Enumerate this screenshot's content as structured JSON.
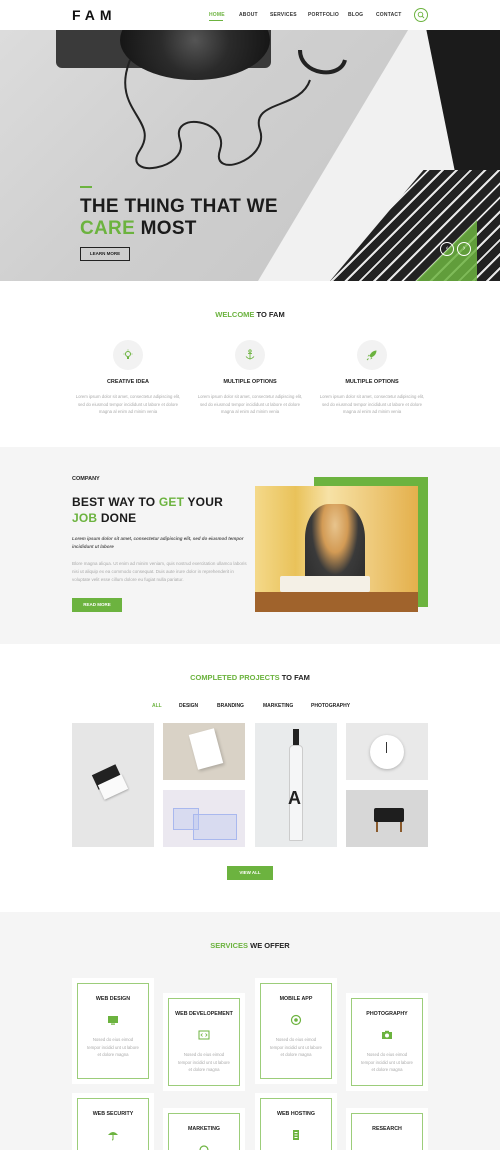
{
  "header": {
    "logo": "FAM",
    "nav": [
      "HOME",
      "ABOUT",
      "SERVICES",
      "PORTFOLIO",
      "BLOG",
      "CONTACT"
    ]
  },
  "hero": {
    "line1": "THE THING THAT WE",
    "line2_accent": "CARE",
    "line2_rest": " MOST",
    "button": "LEARN MORE"
  },
  "welcome": {
    "title_accent": "WELCOME",
    "title_rest": " TO FAM",
    "features": [
      {
        "title": "CREATIVE IDEA",
        "icon": "lightbulb-icon",
        "text": "Lorem ipsum dolor sit amet, consectetur adipiscing elit, sed do eiusmod tempor incididunt ut labore et dolore magna al enim ad minim venia"
      },
      {
        "title": "MULTIPLE OPTIONS",
        "icon": "anchor-icon",
        "text": "Lorem ipsum dolor sit amet, consectetur adipiscing elit, sed do eiusmod tempor incididunt ut labore et dolore magna al enim ad minim venia"
      },
      {
        "title": "MULTIPLE OPTIONS",
        "icon": "rocket-icon",
        "text": "Lorem ipsum dolor sit amet, consectetur adipiscing elit, sed do eiusmod tempor incididunt ut labore et dolore magna al enim ad minim venia"
      }
    ]
  },
  "company": {
    "label": "COMPANY",
    "h1_a": "BEST WAY TO ",
    "h1_accent": "GET",
    "h1_b": " YOUR",
    "h2_accent": "JOB",
    "h2_b": " DONE",
    "italic": "Lorem ipsum dolor sit amet, consectetur adipiscing elit, sed do eiusmod tempor incididunt ut labore",
    "text": "Blore magna aliqua. Ut enim ad minim veniam, quis nostrud exercitation ullamco laboris nisi ut aliquip ex ea commodo consequat. Duis aute irure dolor in reprehenderit in voluptate velit esse cillum dolore eu fugiat nulla pariatur.",
    "button": "READ MORE"
  },
  "projects": {
    "title_accent": "COMPLETED PROJECTS",
    "title_rest": " TO FAM",
    "filters": [
      "ALL",
      "DESIGN",
      "BRANDING",
      "MARKETING",
      "PHOTOGRAPHY"
    ],
    "button": "VIEW ALL"
  },
  "services": {
    "title_accent": "SERVICES",
    "title_rest": " WE OFFER",
    "cards": [
      {
        "title": "WEB DESIGN",
        "icon": "monitor-icon",
        "text": "Nosed do eius eimod tempor incidid unt ut labore et dolore magna"
      },
      {
        "title": "WEB DEVELOPEMENT",
        "icon": "code-icon",
        "text": "Nosed do eius eimod tempor incidid unt ut labore et dolore magna"
      },
      {
        "title": "MOBILE APP",
        "icon": "globe-icon",
        "text": "Nosed do eius eimod tempor incidid unt ut labore et dolore magna"
      },
      {
        "title": "PHOTOGRAPHY",
        "icon": "camera-icon",
        "text": "Nosed do eius eimod tempor incidid unt ut labore et dolore magna"
      },
      {
        "title": "WEB SECURITY",
        "icon": "umbrella-icon"
      },
      {
        "title": "MARKETING",
        "icon": "marketing-icon"
      },
      {
        "title": "WEB HOSTING",
        "icon": "server-icon"
      },
      {
        "title": "RESEARCH",
        "icon": "research-icon"
      }
    ]
  },
  "colors": {
    "accent": "#6cb33f",
    "text": "#222222",
    "muted": "#aaaaaa",
    "section_bg": "#f5f5f5"
  }
}
